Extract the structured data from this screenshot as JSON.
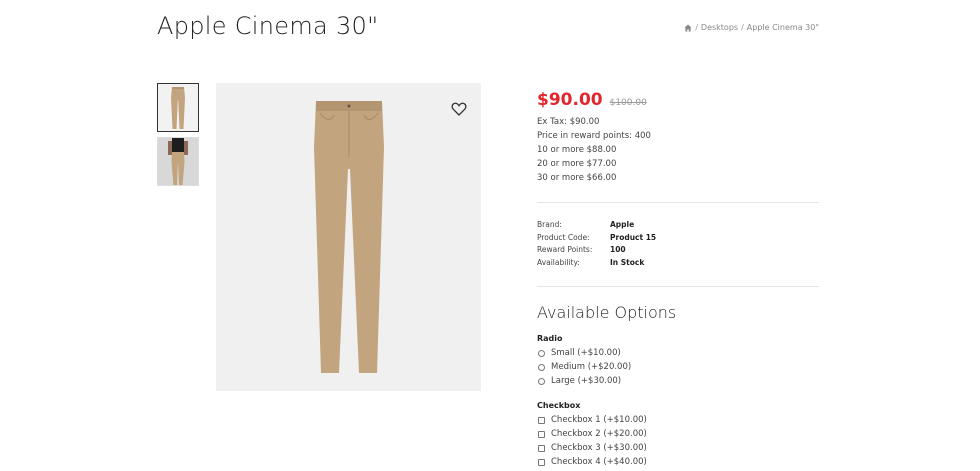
{
  "product": {
    "title": "Apple Cinema 30\""
  },
  "breadcrumb": {
    "items": [
      {
        "label": "Desktops"
      },
      {
        "label": "Apple Cinema 30\""
      }
    ],
    "separator": "/"
  },
  "images": {
    "thumbnails": [
      {
        "alt": "khaki-pants-front"
      },
      {
        "alt": "model-wearing-pants"
      }
    ],
    "main_alt": "khaki-pants"
  },
  "pricing": {
    "price": "$90.00",
    "old_price": "$100.00",
    "ex_tax": "Ex Tax: $90.00",
    "reward_points": "Price in reward points: 400",
    "discounts": [
      "10 or more $88.00",
      "20 or more $77.00",
      "30 or more $66.00"
    ]
  },
  "specs": [
    {
      "label": "Brand:",
      "value": "Apple"
    },
    {
      "label": "Product Code:",
      "value": "Product 15"
    },
    {
      "label": "Reward Points:",
      "value": "100"
    },
    {
      "label": "Availability:",
      "value": "In Stock"
    }
  ],
  "options": {
    "title": "Available Options",
    "radio": {
      "label": "Radio",
      "items": [
        "Small (+$10.00)",
        "Medium (+$20.00)",
        "Large (+$30.00)"
      ]
    },
    "checkbox": {
      "label": "Checkbox",
      "items": [
        "Checkbox 1 (+$10.00)",
        "Checkbox 2 (+$20.00)",
        "Checkbox 3 (+$30.00)",
        "Checkbox 4 (+$40.00)"
      ]
    }
  },
  "colors": {
    "price": "#e3262b",
    "pants": "#c2a47f"
  }
}
